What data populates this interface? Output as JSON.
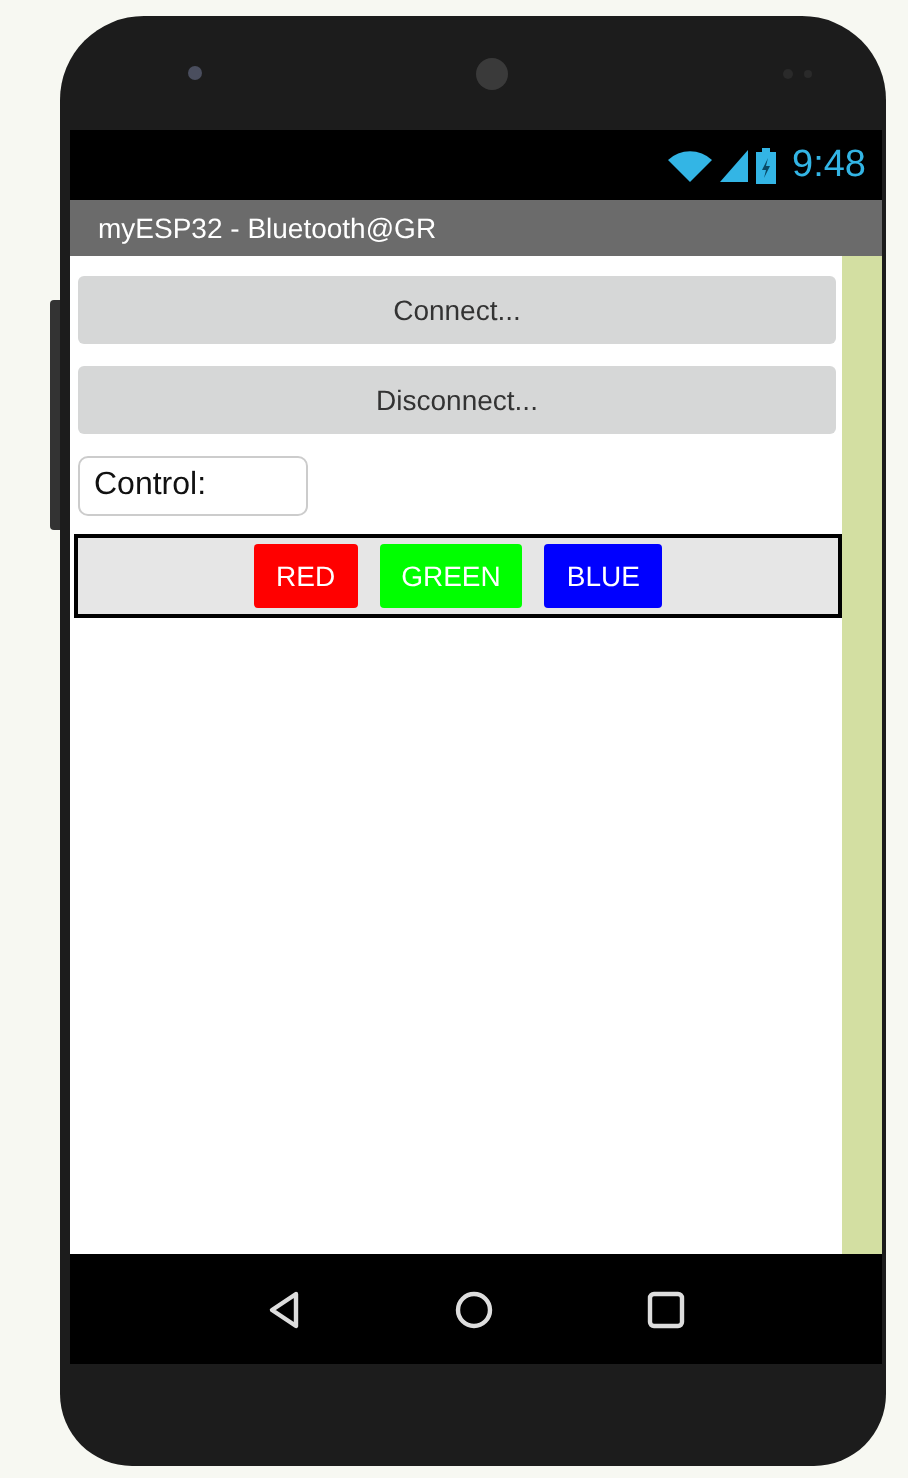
{
  "status_bar": {
    "time": "9:48"
  },
  "title_bar": {
    "title": "myESP32 - Bluetooth@GR"
  },
  "buttons": [
    {
      "label": "Connect..."
    },
    {
      "label": "Disconnect..."
    }
  ],
  "control_field": {
    "value": "Control:"
  },
  "color_buttons": [
    {
      "label": "RED",
      "color": "#ff0000"
    },
    {
      "label": "GREEN",
      "color": "#00ff00"
    },
    {
      "label": "BLUE",
      "color": "#0000ff"
    }
  ]
}
